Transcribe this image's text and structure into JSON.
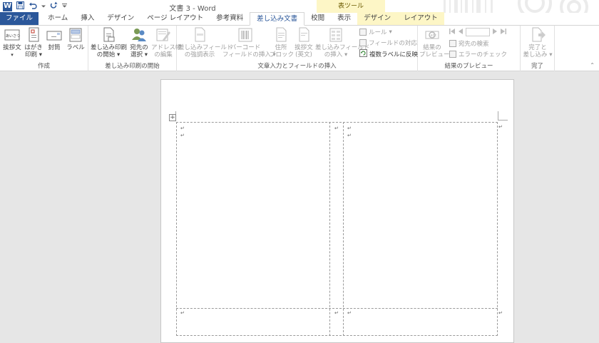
{
  "app": {
    "title": "文書 3 - Word",
    "logo": "W",
    "context_tools_label": "表ツール"
  },
  "qat": {
    "save_icon": "save-icon",
    "undo_icon": "undo-icon",
    "redo_icon": "redo-icon",
    "customize_icon": "customize-icon"
  },
  "tabs": [
    {
      "label": "ファイル"
    },
    {
      "label": "ホーム"
    },
    {
      "label": "挿入"
    },
    {
      "label": "デザイン"
    },
    {
      "label": "ページ レイアウト"
    },
    {
      "label": "参考資料"
    },
    {
      "label": "差し込み文書"
    },
    {
      "label": "校閲"
    },
    {
      "label": "表示"
    },
    {
      "label": "デザイン"
    },
    {
      "label": "レイアウト"
    }
  ],
  "ribbon": {
    "create": {
      "label": "作成",
      "greeting_1": "挨拶文",
      "postcard_1": "はがき",
      "postcard_2": "印刷",
      "envelope": "封筒",
      "label_btn": "ラベル",
      "greeting_icon_text": "あいさつ"
    },
    "start": {
      "label": "差し込み印刷の開始",
      "start_1": "差し込み印刷",
      "start_2": "の開始",
      "select_1": "宛先の",
      "select_2": "選択",
      "edit_1": "アドレス帳",
      "edit_2": "の編集"
    },
    "insert": {
      "label": "文章入力とフィールドの挿入",
      "highlight_1": "差し込みフィールド",
      "highlight_2": "の強調表示",
      "barcode_1": "バーコード",
      "barcode_2": "フィールドの挿入",
      "address_1": "住所",
      "address_2": "ブロック",
      "greet_1": "挨拶文",
      "greet_2": "(英文)",
      "merge_1": "差し込みフィールド",
      "merge_2": "の挿入",
      "rules": "ルール",
      "match": "フィールドの対応",
      "update": "複数ラベルに反映"
    },
    "preview": {
      "label": "結果のプレビュー",
      "preview_1": "結果の",
      "preview_2": "プレビュー",
      "find": "宛先の検索",
      "check": "エラーのチェック",
      "record_value": ""
    },
    "finish": {
      "label": "完了",
      "finish_1": "完了と",
      "finish_2": "差し込み"
    }
  },
  "document": {
    "para_mark": "↵",
    "move_handle": "+"
  }
}
